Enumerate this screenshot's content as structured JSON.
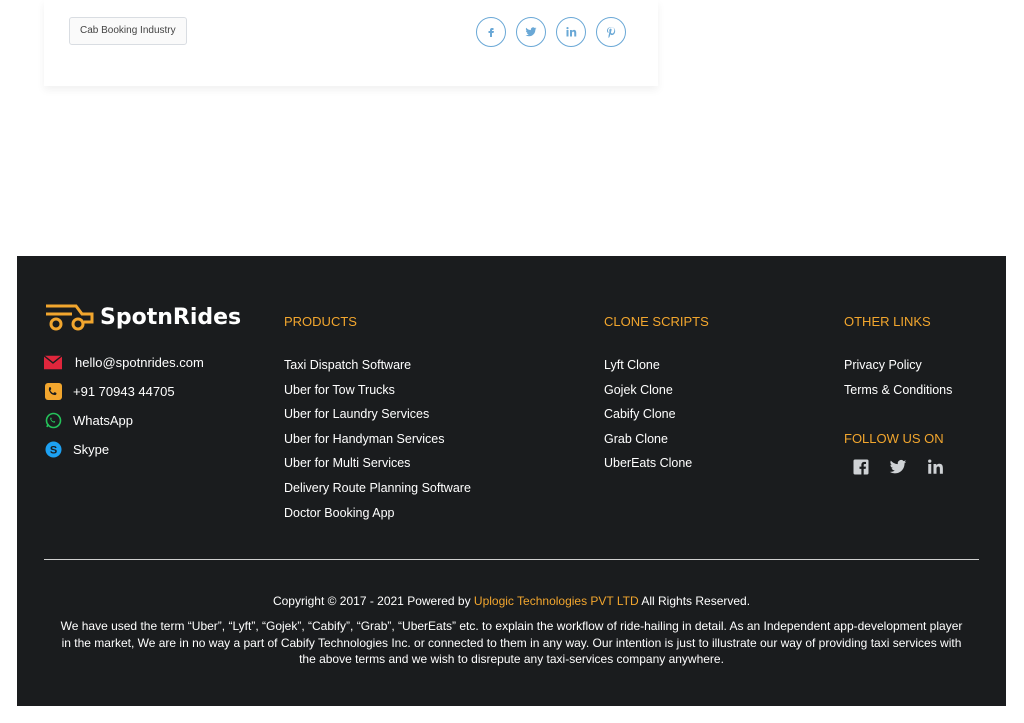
{
  "post": {
    "tag": "Cab Booking Industry",
    "share_icons": [
      "facebook-icon",
      "twitter-icon",
      "linkedin-icon",
      "pinterest-icon"
    ]
  },
  "brand": {
    "name": "SpotnRides",
    "accent": "#f2a62e"
  },
  "contacts": [
    {
      "icon": "mail-icon",
      "label": "hello@spotnrides.com",
      "color": "#e0263c"
    },
    {
      "icon": "phone-icon",
      "label": "+91 70943 44705",
      "color": "#f2a62e"
    },
    {
      "icon": "whatsapp-icon",
      "label": "WhatsApp",
      "color": "#25c25a"
    },
    {
      "icon": "skype-icon",
      "label": "Skype",
      "color": "#1da1f2"
    }
  ],
  "products": {
    "title": "PRODUCTS",
    "items": [
      "Taxi Dispatch Software",
      "Uber for Tow Trucks",
      "Uber for Laundry Services",
      "Uber for Handyman Services",
      "Uber for Multi Services",
      "Delivery Route Planning Software",
      "Doctor Booking App"
    ]
  },
  "clone_scripts": {
    "title": "CLONE SCRIPTS",
    "items": [
      "Lyft Clone",
      "Gojek Clone",
      "Cabify Clone",
      "Grab Clone",
      "UberEats Clone"
    ]
  },
  "other_links": {
    "title": "OTHER LINKS",
    "items": [
      "Privacy Policy",
      "Terms & Conditions"
    ]
  },
  "follow": {
    "title": "FOLLOW US ON",
    "icons": [
      "facebook-square-icon",
      "twitter-icon",
      "linkedin-icon"
    ]
  },
  "copyright": {
    "prefix": "Copyright © 2017 - 2021 Powered by",
    "company": "Uplogic Technologies PVT LTD",
    "suffix": "All Rights Reserved."
  },
  "disclaimer": "We have used the term “Uber”, “Lyft”, “Gojek”, “Cabify”, “Grab”, “UberEats” etc. to explain the workflow of ride-hailing in detail. As an Independent app-development player in the market, We are in no way a part of Cabify Technologies Inc. or connected to them in any way. Our intention is just to illustrate our way of providing taxi services with the above terms and we wish to disrepute any taxi-services company anywhere."
}
